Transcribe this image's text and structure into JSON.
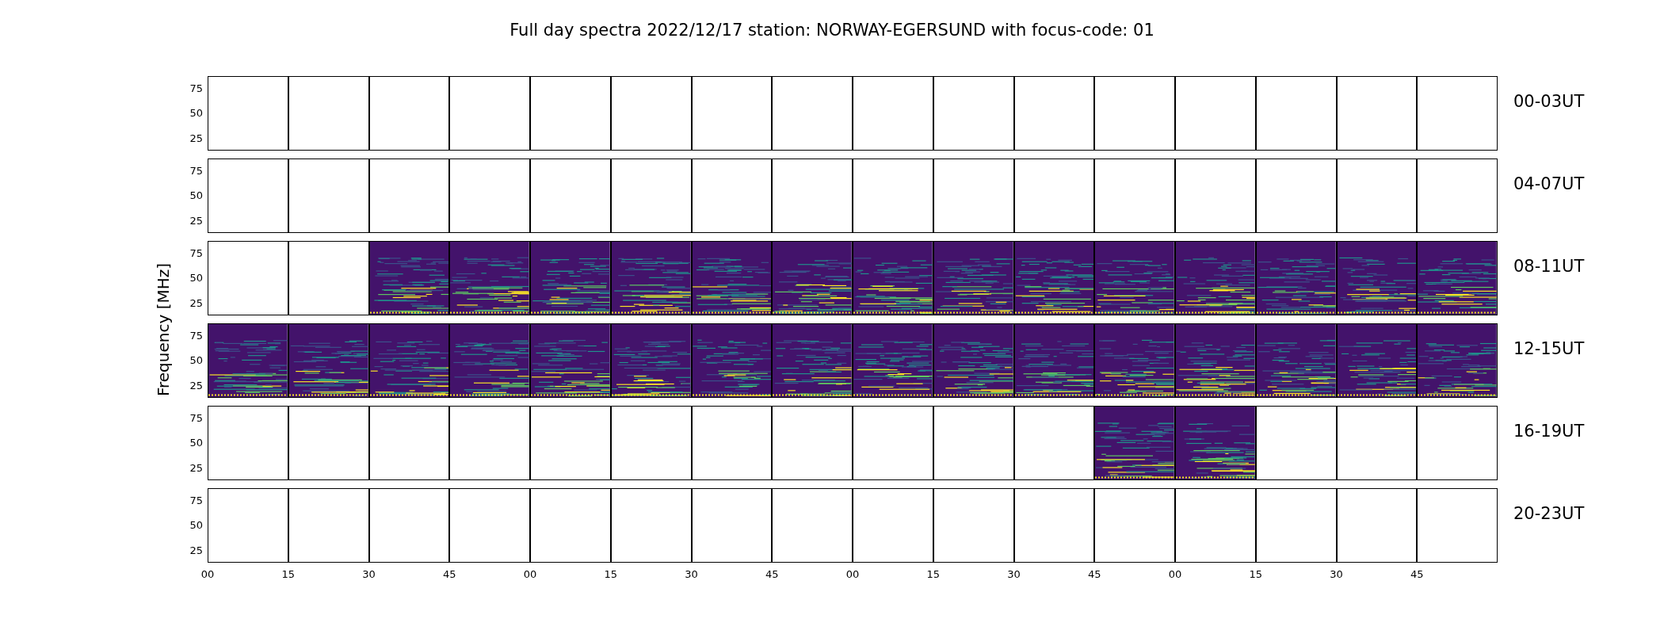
{
  "title": "Full day spectra 2022/12/17 station: NORWAY-EGERSUND with focus-code: 01",
  "ylabel": "Frequency [MHz]",
  "xticks": [
    "00",
    "15",
    "30",
    "45",
    "00",
    "15",
    "30",
    "45",
    "00",
    "15",
    "30",
    "45",
    "00",
    "15",
    "30",
    "45"
  ],
  "rows": [
    {
      "label": "00-03UT",
      "yticks": [
        "75",
        "50",
        "25"
      ],
      "panels": [
        {
          "has_data": false
        },
        {
          "has_data": false
        },
        {
          "has_data": false
        },
        {
          "has_data": false
        },
        {
          "has_data": false
        },
        {
          "has_data": false
        },
        {
          "has_data": false
        },
        {
          "has_data": false
        },
        {
          "has_data": false
        },
        {
          "has_data": false
        },
        {
          "has_data": false
        },
        {
          "has_data": false
        },
        {
          "has_data": false
        },
        {
          "has_data": false
        },
        {
          "has_data": false
        },
        {
          "has_data": false
        }
      ]
    },
    {
      "label": "04-07UT",
      "yticks": [
        "75",
        "50",
        "25"
      ],
      "panels": [
        {
          "has_data": false
        },
        {
          "has_data": false
        },
        {
          "has_data": false
        },
        {
          "has_data": false
        },
        {
          "has_data": false
        },
        {
          "has_data": false
        },
        {
          "has_data": false
        },
        {
          "has_data": false
        },
        {
          "has_data": false
        },
        {
          "has_data": false
        },
        {
          "has_data": false
        },
        {
          "has_data": false
        },
        {
          "has_data": false
        },
        {
          "has_data": false
        },
        {
          "has_data": false
        },
        {
          "has_data": false
        }
      ]
    },
    {
      "label": "08-11UT",
      "yticks": [
        "75",
        "50",
        "25"
      ],
      "panels": [
        {
          "has_data": false
        },
        {
          "has_data": false
        },
        {
          "has_data": true
        },
        {
          "has_data": true
        },
        {
          "has_data": true
        },
        {
          "has_data": true
        },
        {
          "has_data": true
        },
        {
          "has_data": true
        },
        {
          "has_data": true
        },
        {
          "has_data": true
        },
        {
          "has_data": true
        },
        {
          "has_data": true
        },
        {
          "has_data": true
        },
        {
          "has_data": true
        },
        {
          "has_data": true
        },
        {
          "has_data": true
        }
      ]
    },
    {
      "label": "12-15UT",
      "yticks": [
        "75",
        "50",
        "25"
      ],
      "panels": [
        {
          "has_data": true
        },
        {
          "has_data": true
        },
        {
          "has_data": true
        },
        {
          "has_data": true
        },
        {
          "has_data": true
        },
        {
          "has_data": true
        },
        {
          "has_data": true
        },
        {
          "has_data": true
        },
        {
          "has_data": true
        },
        {
          "has_data": true
        },
        {
          "has_data": true
        },
        {
          "has_data": true
        },
        {
          "has_data": true
        },
        {
          "has_data": true
        },
        {
          "has_data": true
        },
        {
          "has_data": true
        }
      ]
    },
    {
      "label": "16-19UT",
      "yticks": [
        "75",
        "50",
        "25"
      ],
      "panels": [
        {
          "has_data": false
        },
        {
          "has_data": false
        },
        {
          "has_data": false
        },
        {
          "has_data": false
        },
        {
          "has_data": false
        },
        {
          "has_data": false
        },
        {
          "has_data": false
        },
        {
          "has_data": false
        },
        {
          "has_data": false
        },
        {
          "has_data": false
        },
        {
          "has_data": false
        },
        {
          "has_data": true
        },
        {
          "has_data": true
        },
        {
          "has_data": false
        },
        {
          "has_data": false
        },
        {
          "has_data": false
        }
      ]
    },
    {
      "label": "20-23UT",
      "yticks": [
        "75",
        "50",
        "25"
      ],
      "panels": [
        {
          "has_data": false
        },
        {
          "has_data": false
        },
        {
          "has_data": false
        },
        {
          "has_data": false
        },
        {
          "has_data": false
        },
        {
          "has_data": false
        },
        {
          "has_data": false
        },
        {
          "has_data": false
        },
        {
          "has_data": false
        },
        {
          "has_data": false
        },
        {
          "has_data": false
        },
        {
          "has_data": false
        },
        {
          "has_data": false
        },
        {
          "has_data": false
        },
        {
          "has_data": false
        },
        {
          "has_data": false
        }
      ]
    }
  ]
}
